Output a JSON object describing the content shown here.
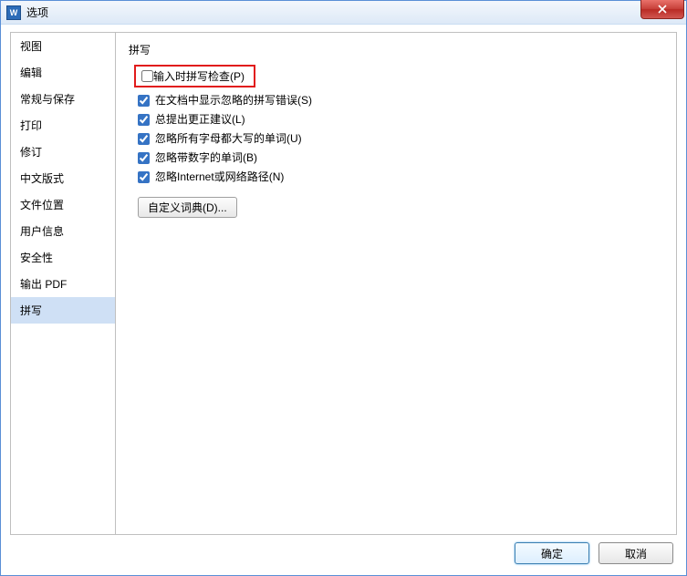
{
  "window": {
    "title": "选项"
  },
  "sidebar": {
    "items": [
      {
        "label": "视图"
      },
      {
        "label": "编辑"
      },
      {
        "label": "常规与保存"
      },
      {
        "label": "打印"
      },
      {
        "label": "修订"
      },
      {
        "label": "中文版式"
      },
      {
        "label": "文件位置"
      },
      {
        "label": "用户信息"
      },
      {
        "label": "安全性"
      },
      {
        "label": "输出 PDF"
      },
      {
        "label": "拼写"
      }
    ],
    "selected_index": 10
  },
  "main": {
    "section_title": "拼写",
    "options": [
      {
        "label": "输入时拼写检查(P)",
        "checked": false,
        "highlighted": true
      },
      {
        "label": "在文档中显示忽略的拼写错误(S)",
        "checked": true
      },
      {
        "label": "总提出更正建议(L)",
        "checked": true
      },
      {
        "label": "忽略所有字母都大写的单词(U)",
        "checked": true
      },
      {
        "label": "忽略带数字的单词(B)",
        "checked": true
      },
      {
        "label": "忽略Internet或网络路径(N)",
        "checked": true
      }
    ],
    "custom_dict_button": "自定义词典(D)..."
  },
  "footer": {
    "ok": "确定",
    "cancel": "取消"
  }
}
